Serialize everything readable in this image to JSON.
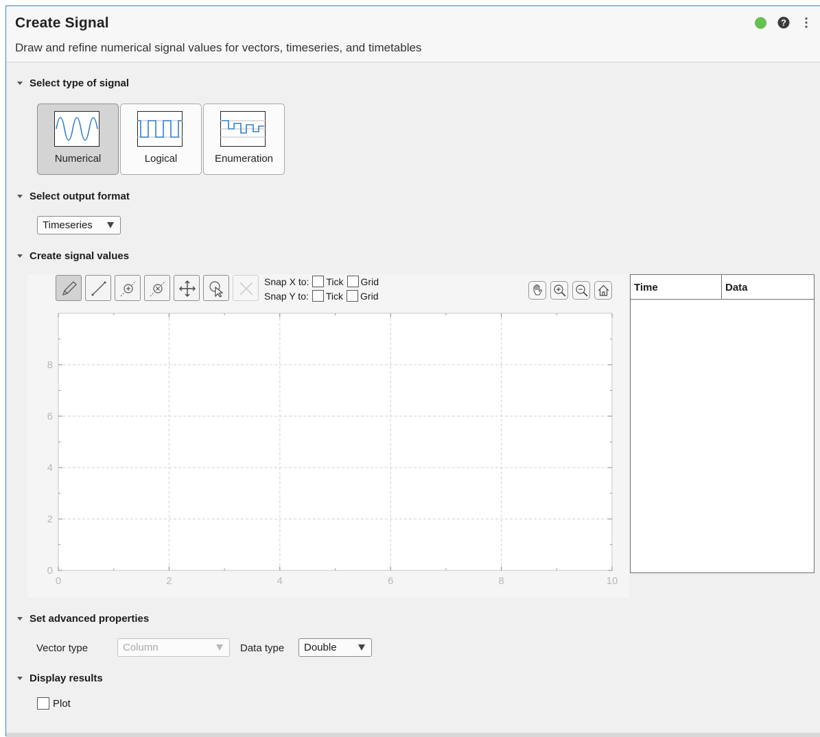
{
  "header": {
    "title": "Create Signal",
    "subtitle": "Draw and refine numerical signal values for vectors, timeseries, and timetables",
    "status_color": "#66c04e"
  },
  "sections": {
    "signal_type": "Select type of signal",
    "output_format": "Select output format",
    "signal_values": "Create signal values",
    "advanced": "Set advanced properties",
    "results": "Display results"
  },
  "signal_types": [
    {
      "label": "Numerical",
      "icon": "sine-wave-icon",
      "selected": true
    },
    {
      "label": "Logical",
      "icon": "square-wave-icon",
      "selected": false
    },
    {
      "label": "Enumeration",
      "icon": "step-wave-icon",
      "selected": false
    }
  ],
  "output_format": {
    "value": "Timeseries"
  },
  "toolbar": {
    "tools": [
      "pencil-icon",
      "line-icon",
      "add-point-icon",
      "remove-point-icon",
      "move-icon",
      "select-icon",
      "delete-icon"
    ],
    "snap_x_label": "Snap X to:",
    "snap_y_label": "Snap Y to:",
    "tick_label": "Tick",
    "grid_label": "Grid",
    "nav": [
      "pan-icon",
      "zoom-in-icon",
      "zoom-out-icon",
      "home-icon"
    ]
  },
  "table": {
    "columns": [
      "Time",
      "Data"
    ],
    "rows": []
  },
  "chart_data": {
    "type": "line",
    "series": [],
    "x_ticks": [
      "0",
      "2",
      "4",
      "6",
      "8",
      "10"
    ],
    "y_ticks": [
      "0",
      "2",
      "4",
      "6",
      "8"
    ],
    "xlim": [
      0,
      10
    ],
    "ylim": [
      0,
      10
    ],
    "grid": true,
    "title": "",
    "xlabel": "",
    "ylabel": ""
  },
  "advanced": {
    "vector_type_label": "Vector type",
    "vector_type_value": "Column",
    "data_type_label": "Data type",
    "data_type_value": "Double"
  },
  "results": {
    "plot_label": "Plot",
    "plot_checked": false
  }
}
